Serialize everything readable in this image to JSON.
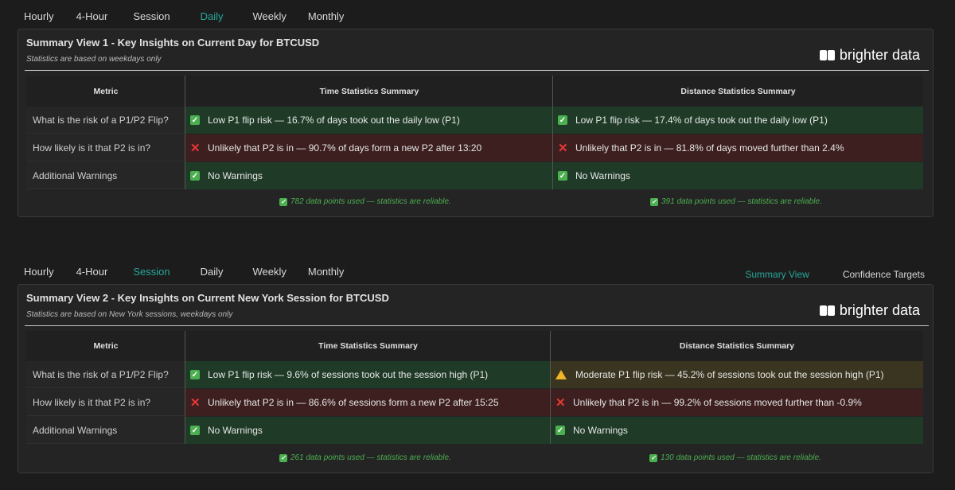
{
  "top_tabs": [
    "Hourly",
    "4-Hour",
    "Session",
    "Daily",
    "Weekly",
    "Monthly"
  ],
  "top_tabs_active": "Daily",
  "second_tabs": [
    "Hourly",
    "4-Hour",
    "Session",
    "Daily",
    "Weekly",
    "Monthly"
  ],
  "second_tabs_active": "Session",
  "view_switch": {
    "summary": "Summary View",
    "confidence": "Confidence Targets"
  },
  "brand": "brighter data",
  "panel1": {
    "title": "Summary View 1 - Key Insights on Current Day for BTCUSD",
    "subtitle": "Statistics are based on weekdays only",
    "headers": {
      "metric": "Metric",
      "time": "Time Statistics Summary",
      "distance": "Distance Statistics Summary"
    },
    "rows": [
      {
        "metric": "What is the risk of a P1/P2 Flip?",
        "time": "Low P1 flip risk — 16.7% of days took out the daily low (P1)",
        "time_status": "ok",
        "distance": "Low P1 flip risk — 17.4% of days took out the daily low (P1)",
        "distance_status": "ok"
      },
      {
        "metric": "How likely is it that P2 is in?",
        "time": "Unlikely that P2 is in — 90.7% of days form a new P2 after 13:20",
        "time_status": "bad",
        "distance": "Unlikely that P2 is in — 81.8% of days moved further than 2.4%",
        "distance_status": "bad"
      },
      {
        "metric": "Additional Warnings",
        "time": "No Warnings",
        "time_status": "ok",
        "distance": "No Warnings",
        "distance_status": "ok"
      }
    ],
    "footer_time": "782 data points used — statistics are reliable.",
    "footer_distance": "391 data points used — statistics are reliable."
  },
  "panel2": {
    "title": "Summary View 2 - Key Insights on Current New York Session for BTCUSD",
    "subtitle": "Statistics are based on New York sessions, weekdays only",
    "headers": {
      "metric": "Metric",
      "time": "Time Statistics Summary",
      "distance": "Distance Statistics Summary"
    },
    "rows": [
      {
        "metric": "What is the risk of a P1/P2 Flip?",
        "time": "Low P1 flip risk — 9.6% of sessions took out the session high (P1)",
        "time_status": "ok",
        "distance": "Moderate P1 flip risk — 45.2% of sessions took out the session high (P1)",
        "distance_status": "warn"
      },
      {
        "metric": "How likely is it that P2 is in?",
        "time": "Unlikely that P2 is in — 86.6% of sessions form a new P2 after 15:25",
        "time_status": "bad",
        "distance": "Unlikely that P2 is in — 99.2% of sessions moved further than -0.9%",
        "distance_status": "bad"
      },
      {
        "metric": "Additional Warnings",
        "time": "No Warnings",
        "time_status": "ok",
        "distance": "No Warnings",
        "distance_status": "ok"
      }
    ],
    "footer_time": "261 data points used — statistics are reliable.",
    "footer_distance": "130 data points used — statistics are reliable."
  }
}
